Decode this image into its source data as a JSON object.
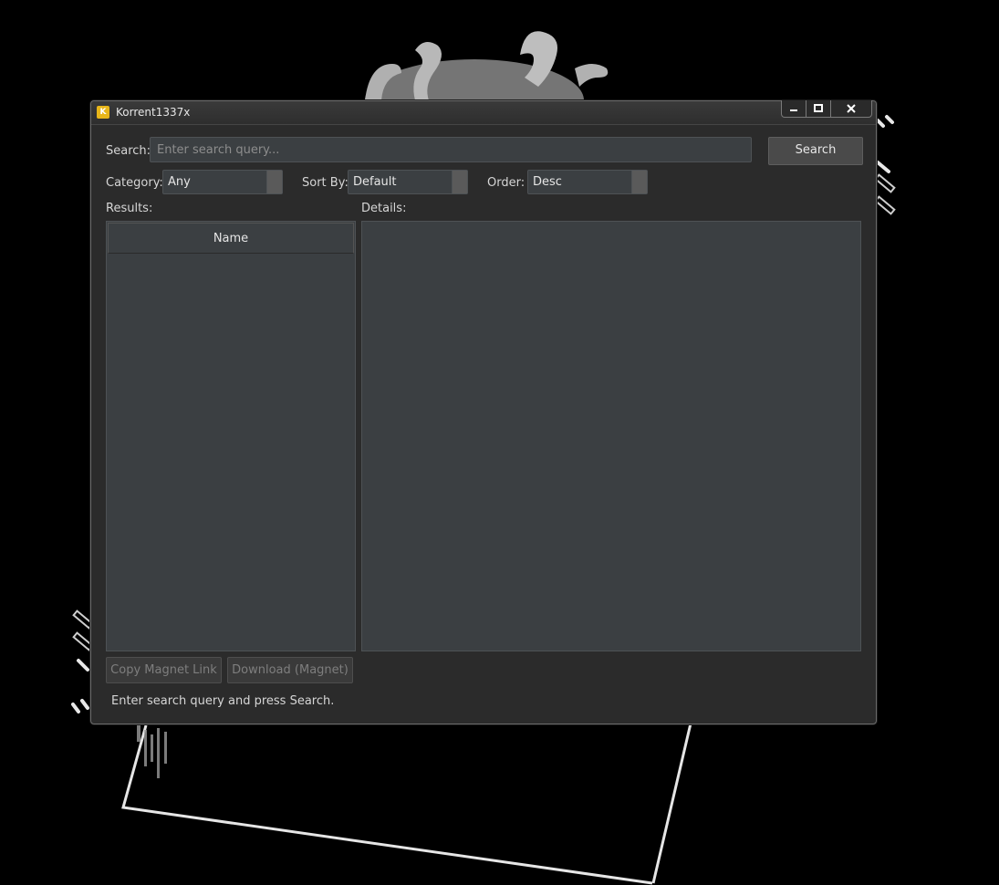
{
  "window": {
    "title": "Korrent1337x",
    "app_icon_glyph": "K",
    "controls": [
      "minimize-icon",
      "maximize-icon",
      "close-icon"
    ]
  },
  "search": {
    "label": "Search:",
    "placeholder": "Enter search query...",
    "value": "",
    "button_label": "Search"
  },
  "filters": {
    "category": {
      "label": "Category:",
      "value": "Any"
    },
    "sort_by": {
      "label": "Sort By:",
      "value": "Default"
    },
    "order": {
      "label": "Order:",
      "value": "Desc"
    }
  },
  "results": {
    "label": "Results:",
    "columns": [
      "Name"
    ],
    "rows": []
  },
  "details": {
    "label": "Details:",
    "text": ""
  },
  "actions": {
    "copy_magnet": "Copy Magnet Link",
    "download_magnet": "Download (Magnet)"
  },
  "status": {
    "message": "Enter search query and press Search."
  },
  "colors": {
    "window_bg": "#2b2b2b",
    "field_bg": "#3b3f42",
    "app_icon": "#e8b61a",
    "desktop_bg": "#000000"
  }
}
